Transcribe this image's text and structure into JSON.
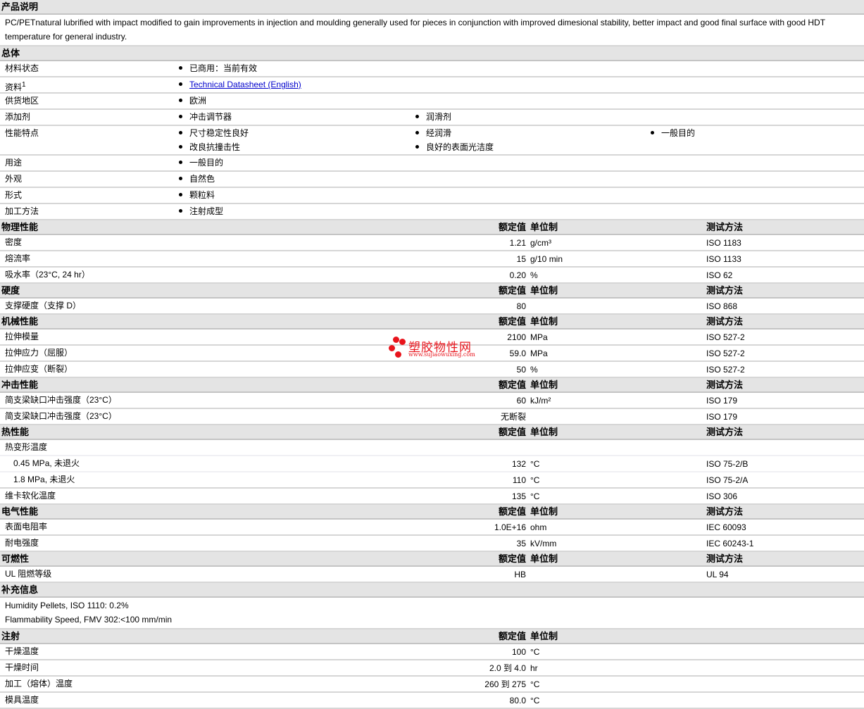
{
  "col_headers": {
    "value": "额定值",
    "unit": "单位制",
    "method": "测试方法"
  },
  "sections": [
    {
      "title": "产品说明",
      "type": "text",
      "lines": [
        "PC/PETnatural lubrified with impact modified to gain improvements in injection and moulding generally used for pieces in conjunction with improved dimesional stability, better impact and good final surface with good HDT temperature for general industry."
      ]
    },
    {
      "title": "总体",
      "type": "bullets",
      "rows": [
        {
          "label": "材料状态",
          "items": [
            "已商用：当前有效"
          ]
        },
        {
          "label": "资料",
          "sup": "1",
          "items": [
            "Technical Datasheet (English)"
          ],
          "link": true
        },
        {
          "label": "供货地区",
          "items": [
            "欧洲"
          ]
        },
        {
          "label": "添加剂",
          "items": [
            "冲击调节器",
            "润滑剂"
          ]
        },
        {
          "label": "性能特点",
          "items": [
            "尺寸稳定性良好",
            "经润滑",
            "一般目的",
            "改良抗撞击性",
            "良好的表面光洁度"
          ]
        },
        {
          "label": "用途",
          "items": [
            "一般目的"
          ]
        },
        {
          "label": "外观",
          "items": [
            "自然色"
          ]
        },
        {
          "label": "形式",
          "items": [
            "颗粒料"
          ]
        },
        {
          "label": "加工方法",
          "items": [
            "注射成型"
          ]
        }
      ]
    },
    {
      "title": "物理性能",
      "type": "props",
      "method": true,
      "rows": [
        {
          "label": "密度",
          "value": "1.21",
          "unit": "g/cm³",
          "method": "ISO 1183"
        },
        {
          "label": "熔流率",
          "value": "15",
          "unit": "g/10 min",
          "method": "ISO 1133"
        },
        {
          "label": "吸水率（23°C, 24 hr）",
          "value": "0.20",
          "unit": "%",
          "method": "ISO 62"
        }
      ]
    },
    {
      "title": "硬度",
      "type": "props",
      "method": true,
      "rows": [
        {
          "label": "支撑硬度（支撑 D）",
          "value": "80",
          "unit": "",
          "method": "ISO 868"
        }
      ]
    },
    {
      "title": "机械性能",
      "type": "props",
      "method": true,
      "rows": [
        {
          "label": "拉伸模量",
          "value": "2100",
          "unit": "MPa",
          "method": "ISO 527-2"
        },
        {
          "label": "拉伸应力（屈服）",
          "value": "59.0",
          "unit": "MPa",
          "method": "ISO 527-2"
        },
        {
          "label": "拉伸应变（断裂）",
          "value": "50",
          "unit": "%",
          "method": "ISO 527-2"
        }
      ]
    },
    {
      "title": "冲击性能",
      "type": "props",
      "method": true,
      "rows": [
        {
          "label": "简支梁缺口冲击强度（23°C）",
          "value": "60",
          "unit": "kJ/m²",
          "method": "ISO 179"
        },
        {
          "label": "简支梁缺口冲击强度（23°C）",
          "value": "无断裂",
          "unit": "",
          "method": "ISO 179"
        }
      ]
    },
    {
      "title": "热性能",
      "type": "props",
      "method": true,
      "rows": [
        {
          "label": "热变形温度",
          "value": "",
          "unit": "",
          "method": "",
          "light": true
        },
        {
          "label": "0.45 MPa, 未退火",
          "value": "132",
          "unit": "°C",
          "method": "ISO 75-2/B",
          "indent": true,
          "light": true
        },
        {
          "label": "1.8 MPa, 未退火",
          "value": "110",
          "unit": "°C",
          "method": "ISO 75-2/A",
          "indent": true
        },
        {
          "label": "维卡软化温度",
          "value": "135",
          "unit": "°C",
          "method": "ISO 306"
        }
      ]
    },
    {
      "title": "电气性能",
      "type": "props",
      "method": true,
      "rows": [
        {
          "label": "表面电阻率",
          "value": "1.0E+16",
          "unit": "ohm",
          "method": "IEC 60093"
        },
        {
          "label": "耐电强度",
          "value": "35",
          "unit": "kV/mm",
          "method": "IEC 60243-1"
        }
      ]
    },
    {
      "title": "可燃性",
      "type": "props",
      "method": true,
      "rows": [
        {
          "label": "UL 阻燃等级",
          "value": "HB",
          "unit": "",
          "method": "UL 94"
        }
      ]
    },
    {
      "title": "补充信息",
      "type": "text",
      "lines": [
        "Humidity Pellets, ISO 1110: 0.2%",
        "Flammability Speed, FMV 302:<100 mm/min"
      ]
    },
    {
      "title": "注射",
      "type": "props",
      "method": false,
      "rows": [
        {
          "label": "干燥温度",
          "value": "100",
          "unit": "°C",
          "method": ""
        },
        {
          "label": "干燥时间",
          "value": "2.0 到  4.0",
          "unit": "hr",
          "method": ""
        },
        {
          "label": "加工（熔体）温度",
          "value": "260 到  275",
          "unit": "°C",
          "method": ""
        },
        {
          "label": "模具温度",
          "value": "80.0",
          "unit": "°C",
          "method": ""
        }
      ]
    }
  ],
  "watermark": {
    "title": "塑胶物性网",
    "url": "www.sujiaowuxing.com",
    "color": "#e8141c"
  }
}
